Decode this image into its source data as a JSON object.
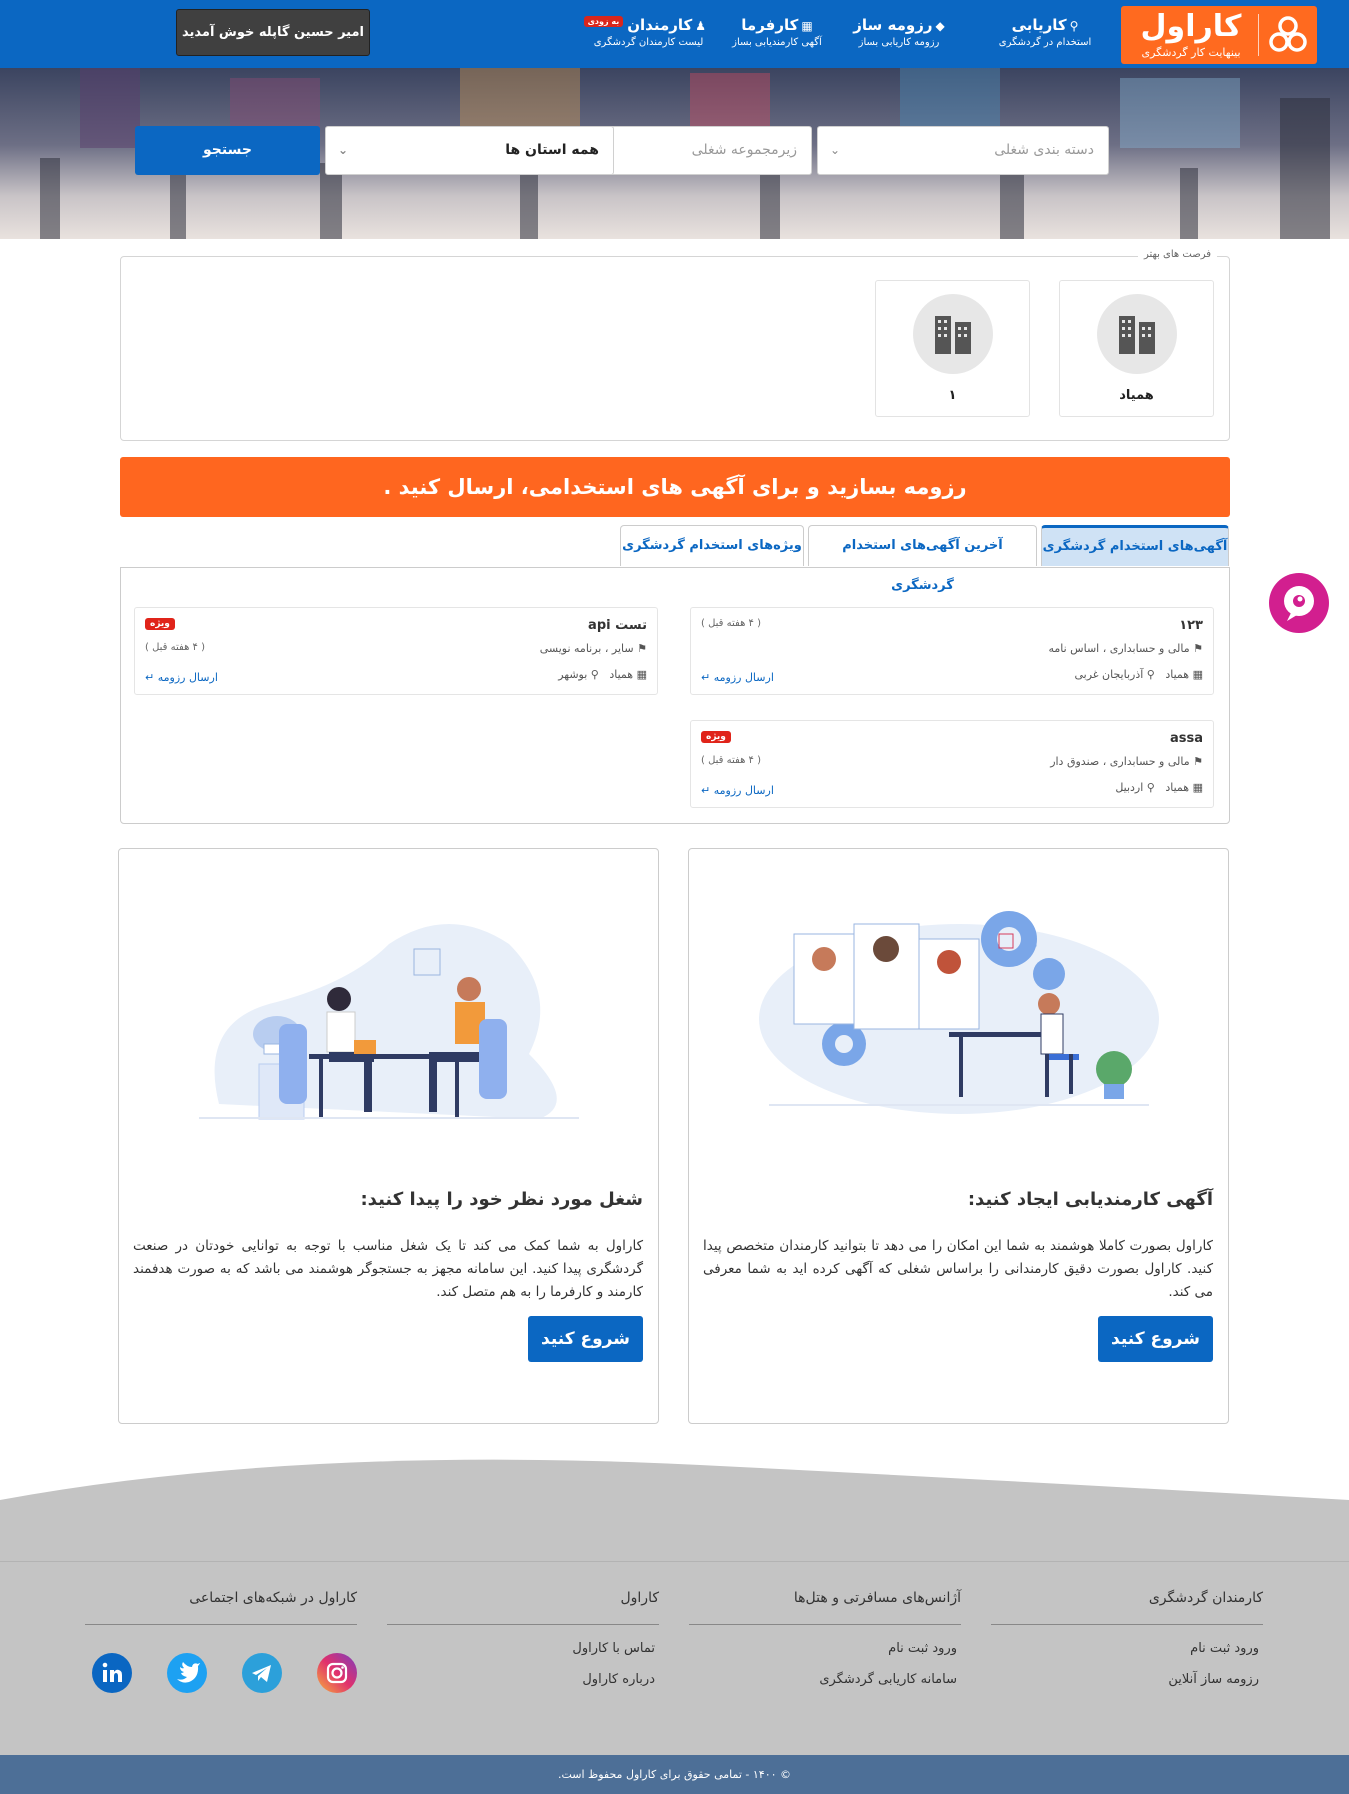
{
  "header": {
    "logo_title": "کاراول",
    "logo_subtitle": "بینهایت کار گردشگری",
    "nav": [
      {
        "title": "کاریابی",
        "subtitle": "استخدام در گردشگری",
        "icon": "search-icon"
      },
      {
        "title": "رزومه ساز",
        "subtitle": "رزومه کاریابی بساز",
        "icon": "diamond-icon"
      },
      {
        "title": "کارفرما",
        "subtitle": "آگهی کارمندیابی بساز",
        "icon": "building-icon"
      },
      {
        "title": "کارمندان",
        "subtitle": "لیست کارمندان گردشگری",
        "icon": "users-icon",
        "badge": "به زودی"
      }
    ],
    "welcome": "امیر حسین گاپله خوش آمدید"
  },
  "search": {
    "category_placeholder": "دسته بندی شغلی",
    "subcategory_placeholder": "زیرمجموعه شغلی",
    "province_value": "همه استان ها",
    "button": "جستجو"
  },
  "opportunities": {
    "legend": "فرصت های بهتر",
    "items": [
      {
        "name": "همیاد"
      },
      {
        "name": "۱"
      }
    ]
  },
  "banner": "رزومه بسازید و برای آگهی های استخدامی، ارسال کنید .",
  "tabs": [
    {
      "label": "آگهی‌های استخدام گردشگری",
      "active": true
    },
    {
      "label": "آخرین آگهی‌های استخدام گردشگری",
      "active": false
    },
    {
      "label": "ویژه‌های استخدام گردشگری",
      "active": false
    }
  ],
  "jobs": [
    {
      "title": "۱۲۳",
      "category": "مالی و حسابداری ، اساس نامه",
      "company": "همیاد",
      "location": "آذربایجان غربی",
      "age": "( ۴ هفته قبل )",
      "send": "ارسال رزومه",
      "special": ""
    },
    {
      "title": "تست api",
      "category": "سایر ، برنامه نویسی",
      "company": "همیاد",
      "location": "بوشهر",
      "age": "( ۴ هفته قبل )",
      "send": "ارسال رزومه",
      "special": "ویژه"
    },
    {
      "title": "assa",
      "category": "مالی و حسابداری ، صندوق دار",
      "company": "همیاد",
      "location": "اردبیل",
      "age": "( ۴ هفته قبل )",
      "send": "ارسال رزومه",
      "special": "ویژه"
    }
  ],
  "features": [
    {
      "title": "آگهی کارمندیابی ایجاد کنید:",
      "text": "کاراول بصورت کاملا هوشمند به شما این امکان را می دهد تا بتوانید کارمندان متخصص پیدا کنید. کاراول بصورت دقیق کارمندانی را براساس شغلی که آگهی کرده اید به شما معرفی می کند.",
      "button": "شروع کنید"
    },
    {
      "title": "شغل مورد نظر خود را پیدا کنید:",
      "text": "کاراول به شما کمک می کند تا یک شغل مناسب با توجه به توانایی خودتان در صنعت گردشگری پیدا کنید. این سامانه مجهز به جستجوگر هوشمند می باشد که به صورت هدفمند کارمند و کارفرما را به هم متصل کند.",
      "button": "شروع کنید"
    }
  ],
  "footer": {
    "columns": [
      {
        "heading": "کارمندان گردشگری",
        "links": [
          "ورود ثبت نام",
          "رزومه ساز آنلاین"
        ]
      },
      {
        "heading": "آژانس‌های مسافرتی و هتل‌ها",
        "links": [
          "ورود ثبت نام",
          "سامانه کاریابی گردشگری"
        ]
      },
      {
        "heading": "کاراول",
        "links": [
          "تماس با کاراول",
          "درباره کاراول"
        ]
      },
      {
        "heading": "کاراول در شبکه‌های اجتماعی",
        "links": []
      }
    ],
    "social": [
      "instagram-icon",
      "telegram-icon",
      "twitter-icon",
      "linkedin-icon"
    ],
    "copyright": "© ۱۴۰۰ - تمامی حقوق برای کاراول محفوظ است."
  },
  "colors": {
    "primary": "#0b67c2",
    "accent": "#ff661f",
    "badge": "#e0241a",
    "chat": "#d21f8f",
    "footer": "#c4c4c4",
    "copyright_bar": "#4d6f97"
  }
}
